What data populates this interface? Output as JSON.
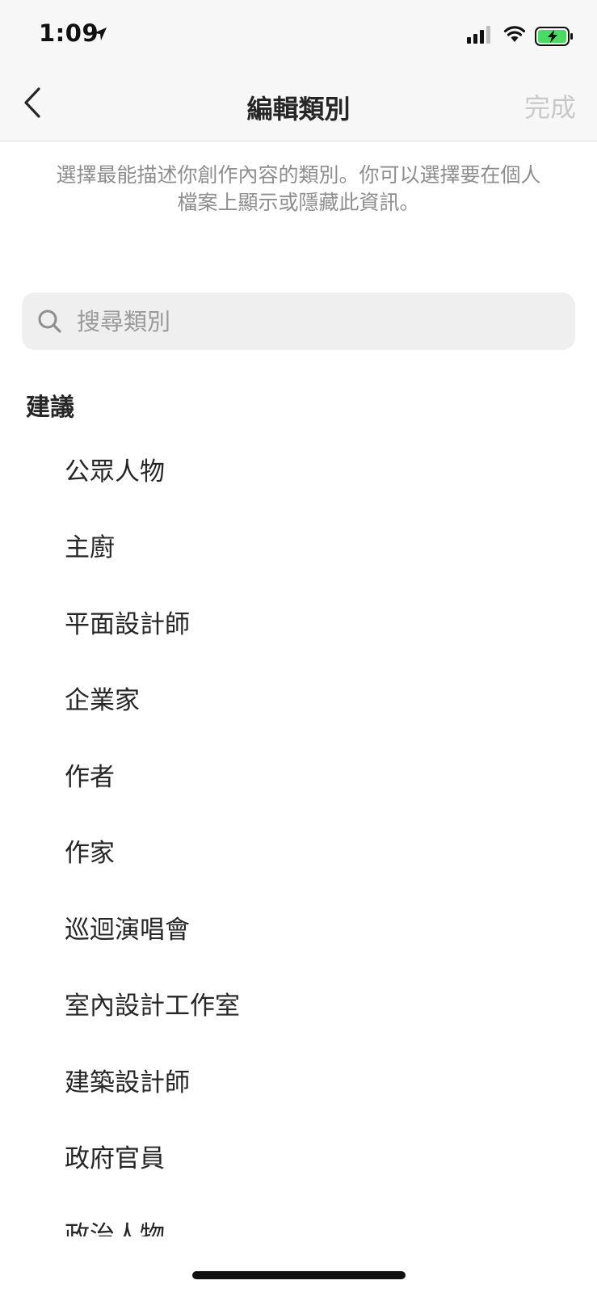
{
  "status_bar": {
    "time": "1:09"
  },
  "nav": {
    "title": "編輯類別",
    "done_label": "完成"
  },
  "description": "選擇最能描述你創作內容的類別。你可以選擇要在個人檔案上顯示或隱藏此資訊。",
  "search": {
    "placeholder": "搜尋類別",
    "value": ""
  },
  "section": {
    "title": "建議"
  },
  "categories": [
    "公眾人物",
    "主廚",
    "平面設計師",
    "企業家",
    "作者",
    "作家",
    "巡迴演唱會",
    "室內設計工作室",
    "建築設計師",
    "政府官員",
    "政治人物"
  ],
  "colors": {
    "nav_background": "#f7f7f7",
    "done_disabled": "#c9c9c9",
    "description_text": "#8e8e8e",
    "search_background": "#efefef",
    "battery_fill": "#4cd964"
  },
  "icons": {
    "back": "chevron-left-icon",
    "search": "magnifier-icon",
    "location": "location-arrow-icon",
    "signal": "cellular-signal-icon",
    "wifi": "wifi-icon",
    "battery": "battery-charging-icon"
  }
}
